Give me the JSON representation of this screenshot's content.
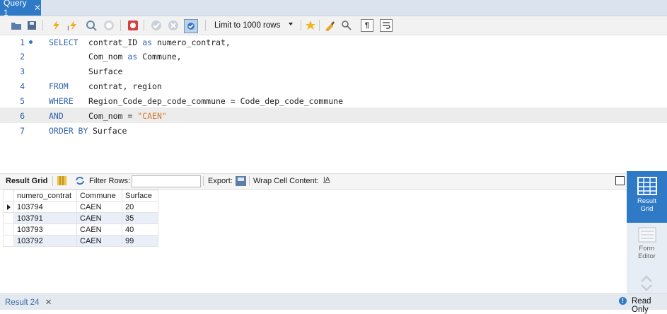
{
  "tab": {
    "title": "Query 1"
  },
  "toolbar": {
    "icons": [
      "folder-icon",
      "save-icon",
      "execute-icon",
      "execute-current-icon",
      "explain-icon",
      "stop-icon",
      "toggle-continue-icon",
      "commit-icon",
      "rollback-icon",
      "autocommit-icon",
      "beautify-icon",
      "find-icon",
      "invisible-chars-icon",
      "wrap-icon"
    ],
    "limit_label": "Limit to 1000 rows"
  },
  "editor": {
    "lines": [
      {
        "num": "1",
        "keyword": "SELECT",
        "code": "contrat_ID as numero_contrat,"
      },
      {
        "num": "2",
        "keyword": "",
        "code": "Com_nom as Commune,"
      },
      {
        "num": "3",
        "keyword": "",
        "code": "Surface"
      },
      {
        "num": "4",
        "keyword": "FROM",
        "code": "contrat, region"
      },
      {
        "num": "5",
        "keyword": "WHERE",
        "code": "Region_Code_dep_code_commune = Code_dep_code_commune"
      },
      {
        "num": "6",
        "keyword": "AND",
        "code": "Com_nom = \"CAEN\""
      },
      {
        "num": "7",
        "keyword": "ORDER BY",
        "code": "Surface"
      }
    ],
    "line1_as": "as",
    "line1_rest": "numero_contrat,",
    "line1_a": "contrat_ID",
    "line2_a": "Com_nom",
    "line2_as": "as",
    "line2_rest": "Commune,",
    "line6_a": "Com_nom = ",
    "line6_str": "\"CAEN\"",
    "line7_kw_a": "ORDER BY"
  },
  "results": {
    "result_grid_label": "Result Grid",
    "filter_label": "Filter Rows:",
    "filter_value": "",
    "export_label": "Export:",
    "wrap_label": "Wrap Cell Content:",
    "columns": [
      "numero_contrat",
      "Commune",
      "Surface"
    ],
    "rows": [
      [
        "103794",
        "CAEN",
        "20"
      ],
      [
        "103791",
        "CAEN",
        "35"
      ],
      [
        "103793",
        "CAEN",
        "40"
      ],
      [
        "103792",
        "CAEN",
        "99"
      ]
    ]
  },
  "side_panel": {
    "result_grid_btn": [
      "Result",
      "Grid"
    ],
    "form_editor_btn": [
      "Form",
      "Editor"
    ]
  },
  "status": {
    "result_tab": "Result 24",
    "read_only": "Read Only"
  },
  "colors": {
    "accent": "#2f7ac7",
    "keyword": "#2f63b0",
    "string": "#d4782a"
  }
}
